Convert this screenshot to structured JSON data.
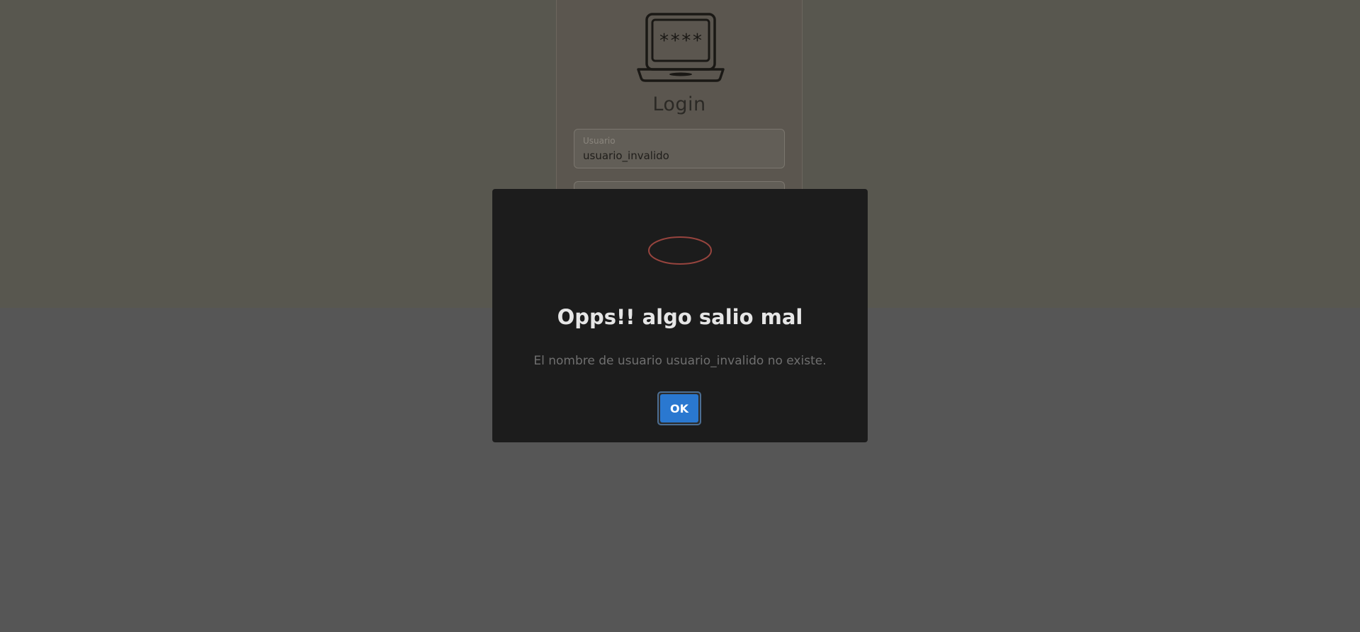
{
  "login": {
    "title": "Login",
    "username_label": "Usuario",
    "username_value": "usuario_invalido",
    "password_value": "",
    "icon_text": "****"
  },
  "dialog": {
    "title": "Opps!! algo salio mal",
    "message": "El nombre de usuario usuario_invalido no existe.",
    "ok_label": "OK",
    "icon": "error-icon"
  },
  "colors": {
    "modal_background": "#1c1c1c",
    "ok_button": "#2a78d0",
    "error_icon_ring": "#c0524a",
    "overlay": "#565656"
  }
}
